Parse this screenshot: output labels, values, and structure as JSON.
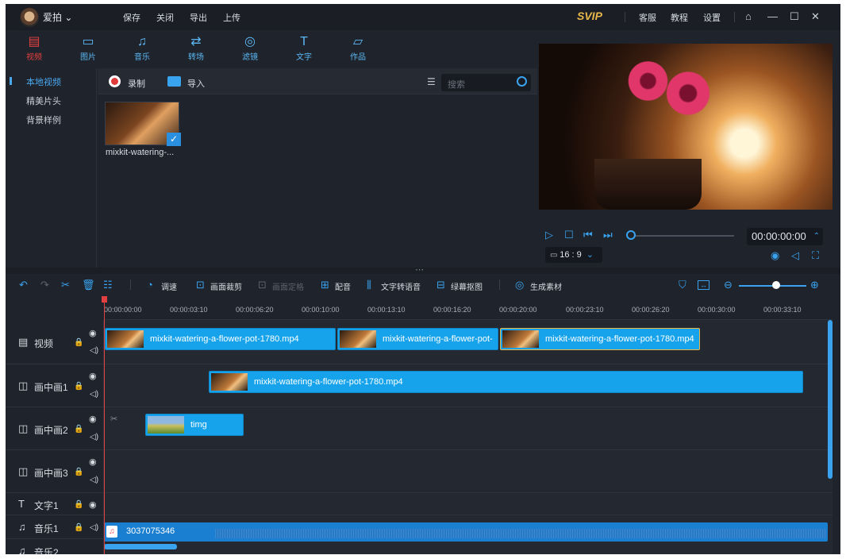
{
  "titlebar": {
    "app_name": "爱拍",
    "menu": [
      "保存",
      "关闭",
      "导出",
      "上传"
    ],
    "svip": "SVIP",
    "links": [
      "客服",
      "教程",
      "设置"
    ]
  },
  "media_tabs": [
    {
      "label": "视频",
      "icon": "film-icon",
      "active": true
    },
    {
      "label": "图片",
      "icon": "image-icon"
    },
    {
      "label": "音乐",
      "icon": "music-icon"
    },
    {
      "label": "转场",
      "icon": "transition-icon"
    },
    {
      "label": "滤镜",
      "icon": "filter-icon"
    },
    {
      "label": "文字",
      "icon": "text-icon"
    },
    {
      "label": "作品",
      "icon": "folder-icon"
    }
  ],
  "leftnav": [
    "本地视频",
    "精美片头",
    "背景样例"
  ],
  "media_toolbar": {
    "record": "录制",
    "import": "导入",
    "search_placeholder": "搜索"
  },
  "media_bin": [
    {
      "label": "mixkit-watering-..."
    }
  ],
  "preview": {
    "timecode": "00:00:00:00",
    "ratio": "16 : 9"
  },
  "timeline_toolbar": {
    "adjust": "调速",
    "crop": "画面裁剪",
    "freeze": "画面定格",
    "dub": "配音",
    "tts": "文字转语音",
    "chroma": "绿幕抠图",
    "generate": "生成素材"
  },
  "ruler_ticks": [
    "00:00:00:00",
    "00:00:03:10",
    "00:00:06:20",
    "00:00:10:00",
    "00:00:13:10",
    "00:00:16:20",
    "00:00:20:00",
    "00:00:23:10",
    "00:00:26:20",
    "00:00:30:00",
    "00:00:33:10"
  ],
  "tracks": {
    "video": "视频",
    "pip1": "画中画1",
    "pip2": "画中画2",
    "pip3": "画中画3",
    "text1": "文字1",
    "music1": "音乐1",
    "music2": "音乐2"
  },
  "clips": {
    "v1": "mixkit-watering-a-flower-pot-1780.mp4",
    "v2": "mixkit-watering-a-flower-pot-",
    "v3": "mixkit-watering-a-flower-pot-1780.mp4",
    "pip1": "mixkit-watering-a-flower-pot-1780.mp4",
    "pip2": "timg",
    "audio": "3037075346"
  },
  "colors": {
    "accent": "#3aa3ef",
    "active_tab": "#e04040",
    "svip": "#e8b84a",
    "clip": "#16a3ec"
  }
}
